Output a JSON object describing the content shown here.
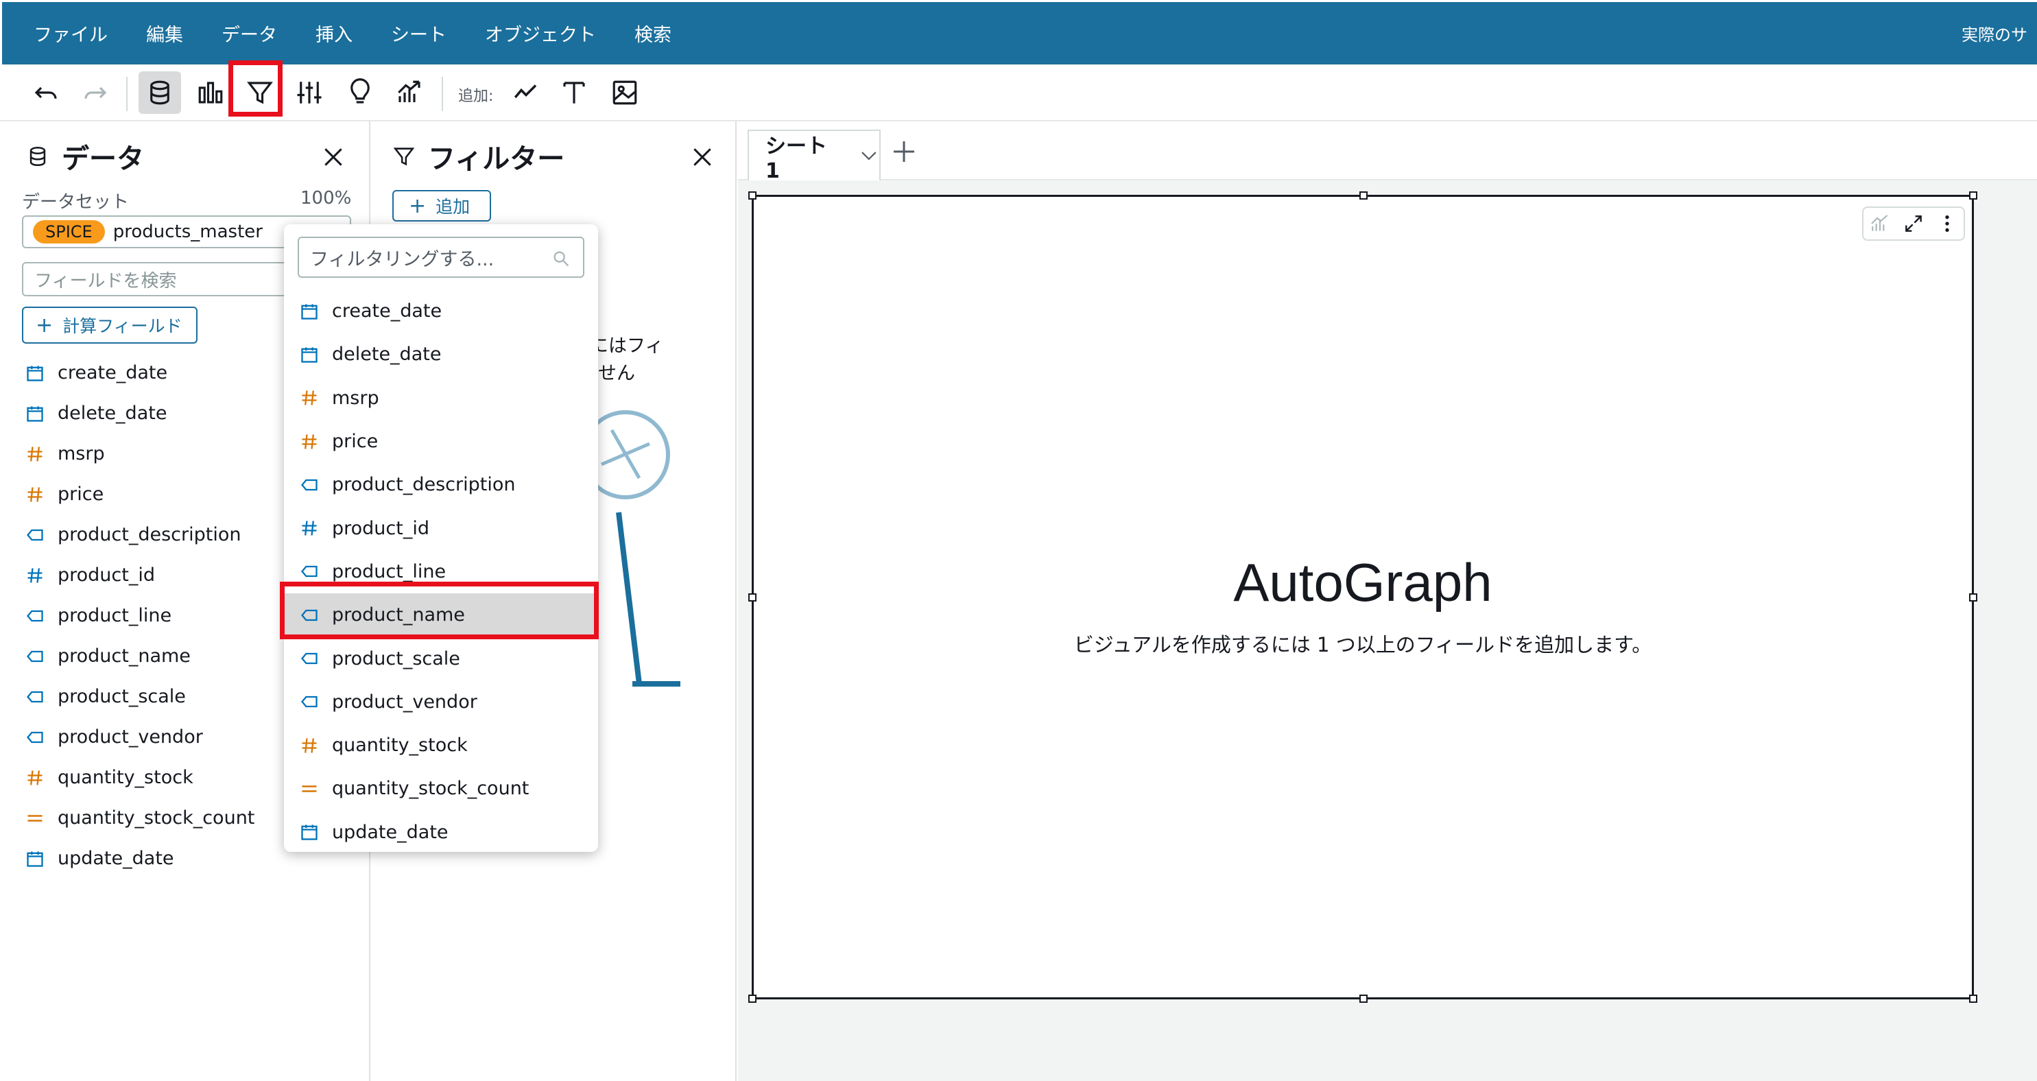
{
  "menubar": {
    "items": [
      "ファイル",
      "編集",
      "データ",
      "挿入",
      "シート",
      "オブジェクト",
      "検索"
    ],
    "right_text": "実際のサ"
  },
  "toolbar": {
    "buttons": [
      "undo-icon",
      "redo-icon",
      "data-icon",
      "visualize-icon",
      "filter-icon",
      "parameters-icon",
      "insights-icon",
      "forecast-icon"
    ],
    "add_label": "追加:",
    "add_buttons": [
      "line-chart-icon",
      "text-box-icon",
      "image-icon"
    ],
    "active": "data-icon",
    "highlighted": "filter-icon"
  },
  "data_panel": {
    "title": "データ",
    "dataset_label": "データセット",
    "spice_pct": "100%",
    "spice_badge": "SPICE",
    "dataset_name": "products_master",
    "search_placeholder": "フィールドを検索",
    "calc_field_label": "計算フィールド",
    "fields": [
      {
        "name": "create_date",
        "type": "date"
      },
      {
        "name": "delete_date",
        "type": "date"
      },
      {
        "name": "msrp",
        "type": "measure"
      },
      {
        "name": "price",
        "type": "measure"
      },
      {
        "name": "product_description",
        "type": "dimension"
      },
      {
        "name": "product_id",
        "type": "dim-number"
      },
      {
        "name": "product_line",
        "type": "dimension"
      },
      {
        "name": "product_name",
        "type": "dimension"
      },
      {
        "name": "product_scale",
        "type": "dimension"
      },
      {
        "name": "product_vendor",
        "type": "dimension"
      },
      {
        "name": "quantity_stock",
        "type": "measure"
      },
      {
        "name": "quantity_stock_count",
        "type": "calc"
      },
      {
        "name": "update_date",
        "type": "date"
      }
    ]
  },
  "filter_panel": {
    "title": "フィルター",
    "add_label": "追加",
    "empty_line1": "にはフィ",
    "empty_line2": "せん"
  },
  "dropdown": {
    "search_placeholder": "フィルタリングする...",
    "selected": "product_name"
  },
  "canvas": {
    "sheet_tab": "シート 1",
    "visual_title": "AutoGraph",
    "visual_subtitle": "ビジュアルを作成するには 1 つ以上のフィールドを追加します。"
  },
  "colors": {
    "menubar": "#1b6f9c",
    "date_icon": "#0073bb",
    "measure_icon": "#d97706",
    "dimension_icon": "#0073bb",
    "highlight_box": "#e8101c",
    "spice": "#f89b1c"
  }
}
